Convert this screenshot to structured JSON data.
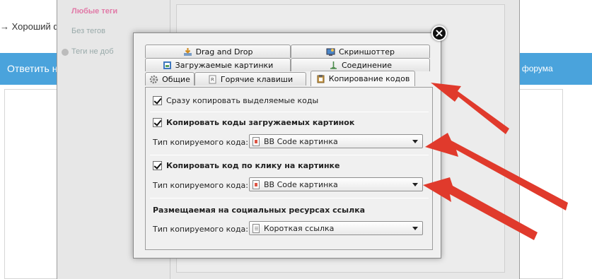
{
  "background": {
    "breadcrumb": "→ Хороший ф",
    "reply_button": "Ответить н",
    "forum_link": "я форума",
    "sidebar": {
      "favorite_tags": "Любые теги",
      "no_tags": "Без тегов",
      "unavailable_tags": "Теги не доб"
    }
  },
  "dialog": {
    "close_symbol": "×",
    "tabs": [
      {
        "label": "Drag and Drop",
        "icon": "drag-drop-icon"
      },
      {
        "label": "Скриншоттер",
        "icon": "screenshot-icon"
      },
      {
        "label": "Загружаемые картинки",
        "icon": "images-icon"
      },
      {
        "label": "Соединение",
        "icon": "connection-icon"
      },
      {
        "label": "Общие",
        "icon": "gear-icon"
      },
      {
        "label": "Горячие клавиши",
        "icon": "keyboard-icon"
      },
      {
        "label": "Копирование кодов",
        "icon": "clipboard-icon"
      }
    ],
    "active_tab": "Копирование кодов",
    "options": {
      "copy_selected": "Сразу копировать выделяемые коды",
      "copy_uploaded": "Копировать коды загружаемых картинок",
      "copy_on_click": "Копировать код по клику на картинке",
      "social_link_title": "Размещаемая на социальных ресурсах ссылка",
      "code_type_label": "Тип копируемого кода:"
    },
    "selects": {
      "uploaded_value": "BB Code картинка",
      "click_value": "BB Code картинка",
      "social_value": "Короткая ссылка"
    }
  },
  "colors": {
    "blue_bar": "#4aa3dc",
    "arrow_red": "#e03a2c",
    "favorite_tag_pink": "#e17ba8"
  }
}
